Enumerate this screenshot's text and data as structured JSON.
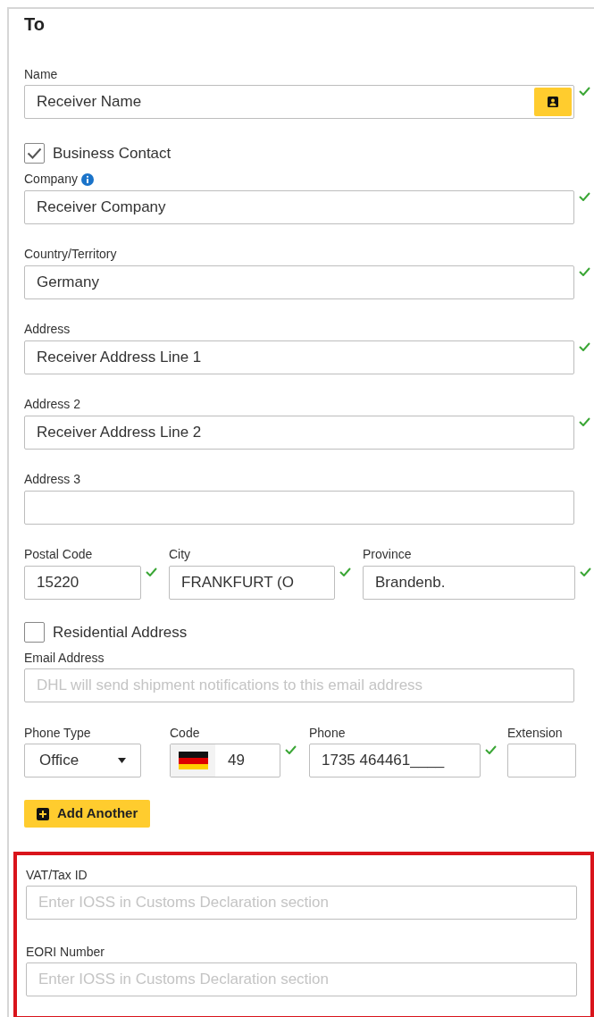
{
  "title": "To",
  "name": {
    "label": "Name",
    "value": "Receiver Name",
    "valid": true
  },
  "business_contact": {
    "label": "Business Contact",
    "checked": true
  },
  "company": {
    "label": "Company",
    "value": "Receiver Company",
    "valid": true
  },
  "text_fields": [
    {
      "label": "Country/Territory",
      "value": "Germany",
      "valid": true
    },
    {
      "label": "Address",
      "value": "Receiver Address Line 1",
      "valid": true
    },
    {
      "label": "Address 2",
      "value": "Receiver Address Line 2",
      "valid": true
    },
    {
      "label": "Address 3",
      "valid": false
    }
  ],
  "location": [
    {
      "label": "Postal Code",
      "value": "15220",
      "valid": true
    },
    {
      "label": "City",
      "value": "FRANKFURT (O",
      "valid": true
    },
    {
      "label": "Province",
      "value": "Brandenb.",
      "valid": true
    }
  ],
  "residential": {
    "label": "Residential Address",
    "checked": false
  },
  "email": {
    "label": "Email Address",
    "placeholder": "DHL will send shipment notifications to this email address"
  },
  "phone_type": {
    "label": "Phone Type",
    "value": "Office"
  },
  "code": {
    "label": "Code",
    "value": "49",
    "valid": true
  },
  "phone": {
    "label": "Phone",
    "value": "1735 464461____",
    "valid": true
  },
  "extension": {
    "label": "Extension"
  },
  "add_button": "Add Another",
  "highlighted_fields": [
    {
      "label": "VAT/Tax ID",
      "placeholder": "Enter IOSS in Customs Declaration section"
    },
    {
      "label": "EORI Number",
      "placeholder": "Enter IOSS in Customs Declaration section"
    }
  ]
}
